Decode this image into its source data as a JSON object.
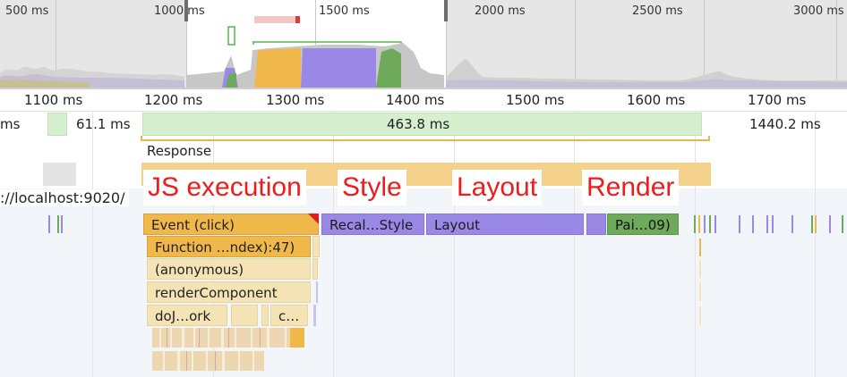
{
  "overview": {
    "time_labels": [
      "500 ms",
      "1000 ms",
      "1500 ms",
      "2000 ms",
      "2500 ms",
      "3000 ms"
    ]
  },
  "ruler": {
    "time_labels": [
      "1100 ms",
      "1200 ms",
      "1300 ms",
      "1400 ms",
      "1500 ms",
      "1600 ms",
      "1700 ms"
    ]
  },
  "frames": {
    "left_partial": "ms",
    "frame_a": "61.1 ms",
    "frame_main": "463.8 ms",
    "frame_c": "1440.2 ms"
  },
  "interactions": {
    "response_label": "Response"
  },
  "main_thread": {
    "url_label": "://localhost:9020/"
  },
  "annotations": {
    "js_execution": "JS execution",
    "style": "Style",
    "layout": "Layout",
    "render": "Render"
  },
  "flame": {
    "event_click": "Event (click)",
    "function_call": "Function …ndex):47)",
    "anonymous": "(anonymous)",
    "render_component": "renderComponent",
    "do_work": "doJ…ork",
    "c_short": "c…",
    "recalc_style": "Recal…Style",
    "layout": "Layout",
    "paint": "Pai…09)"
  },
  "colors": {
    "scripting": "#f0b84a",
    "rendering": "#9a88e6",
    "painting": "#6fa95b",
    "frame": "#d5efcf",
    "annotation": "#ee1c1c"
  }
}
